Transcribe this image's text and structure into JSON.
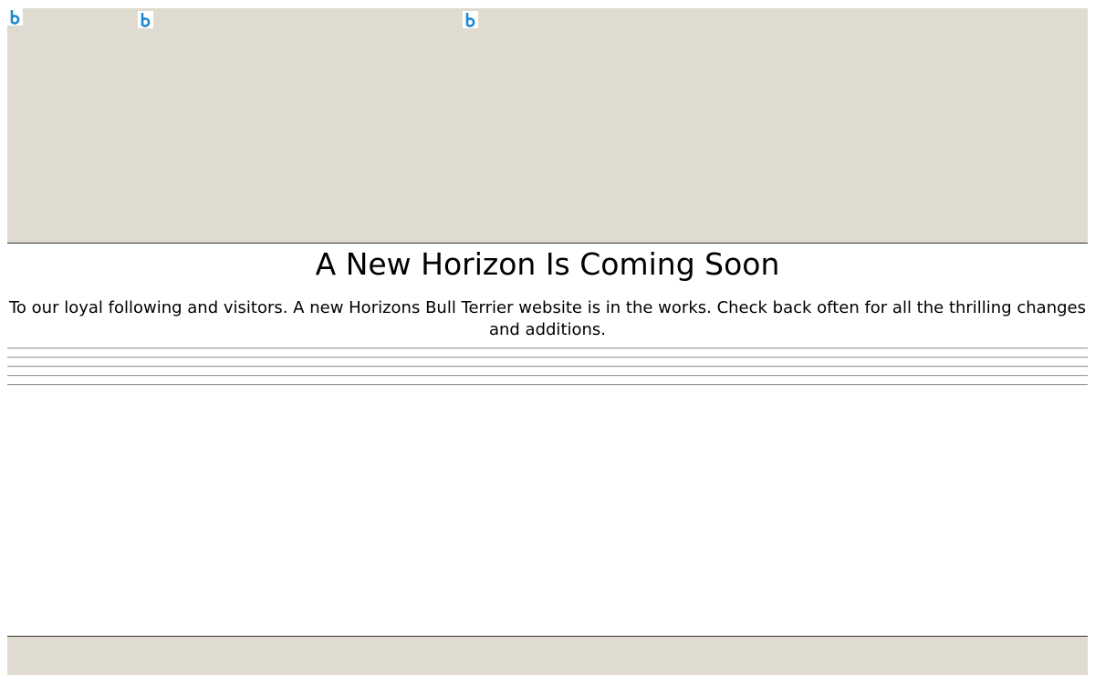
{
  "header": {
    "images": [
      {
        "icon": "broken-image-b-icon",
        "color": "#1e88d2"
      },
      {
        "icon": "broken-image-b-icon",
        "color": "#1e88d2"
      },
      {
        "icon": "broken-image-b-icon",
        "color": "#1e88d2"
      }
    ],
    "background": "#dfdbd0"
  },
  "main": {
    "headline": "A New Horizon Is Coming Soon",
    "intro": "To our loyal following and visitors. A new Horizons Bull Terrier website is in the works. Check back often for all the thrilling changes and additions."
  },
  "dividers": {
    "count": 5,
    "color": "#9a9a9a"
  },
  "footer": {
    "background": "#dfdbd0"
  }
}
